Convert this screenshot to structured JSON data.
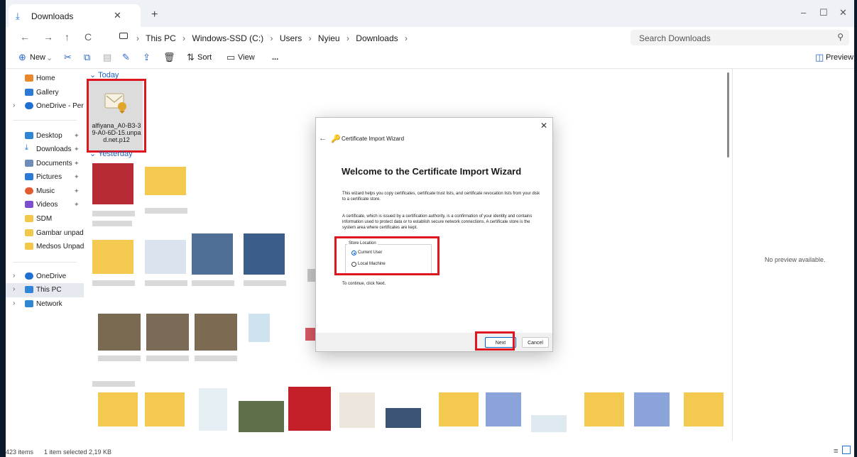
{
  "tab": {
    "title": "Downloads",
    "close": "✕",
    "new": "+"
  },
  "window_controls": [
    "–",
    "☐",
    "✕"
  ],
  "nav_buttons": [
    "←",
    "→",
    "↑",
    "C"
  ],
  "breadcrumb": [
    "This PC",
    "Windows-SSD (C:)",
    "Users",
    "Nyieu",
    "Downloads"
  ],
  "search": {
    "placeholder": "Search Downloads"
  },
  "toolbar": {
    "new_label": "New",
    "sort_label": "Sort",
    "view_label": "View",
    "more_label": "...",
    "preview_label": "Preview"
  },
  "sidebar": {
    "items": [
      {
        "label": "Home",
        "icon": "home-icon",
        "color": "#e9872b"
      },
      {
        "label": "Gallery",
        "icon": "gallery-icon",
        "color": "#2b7bd6"
      },
      {
        "label": "OneDrive - Persona",
        "icon": "cloud-icon",
        "color": "#1f6fd1"
      },
      {
        "label": "Desktop",
        "icon": "desktop-icon",
        "color": "#2f86d4"
      },
      {
        "label": "Downloads",
        "icon": "download-icon",
        "color": "#1f6fd1"
      },
      {
        "label": "Documents",
        "icon": "documents-icon",
        "color": "#6c8db8"
      },
      {
        "label": "Pictures",
        "icon": "pictures-icon",
        "color": "#2b7bd6"
      },
      {
        "label": "Music",
        "icon": "music-icon",
        "color": "#e25b32"
      },
      {
        "label": "Videos",
        "icon": "videos-icon",
        "color": "#7b4fd0"
      },
      {
        "label": "SDM",
        "icon": "folder-icon",
        "color": "#f2c84b"
      },
      {
        "label": "Gambar unpad",
        "icon": "folder-icon",
        "color": "#f2c84b"
      },
      {
        "label": "Medsos Unpad",
        "icon": "folder-icon",
        "color": "#f2c84b"
      },
      {
        "label": "OneDrive",
        "icon": "cloud-icon",
        "color": "#1f6fd1"
      },
      {
        "label": "This PC",
        "icon": "pc-icon",
        "color": "#2f86d4"
      },
      {
        "label": "Network",
        "icon": "network-icon",
        "color": "#2f86d4"
      }
    ]
  },
  "groups": {
    "today": "Today",
    "yesterday": "Yesterday"
  },
  "selected_file": {
    "name": "alfiyana_A0-B3-39-A0-6D-15.unpad.net.p12"
  },
  "preview_pane": {
    "message": "No preview available."
  },
  "status_bar": {
    "items": "423 items",
    "selected": "1 item selected  2,19 KB"
  },
  "dialog": {
    "title": "Certificate Import Wizard",
    "heading": "Welcome to the Certificate Import Wizard",
    "para1": "This wizard helps you copy certificates, certificate trust lists, and certificate revocation lists from your disk to a certificate store.",
    "para2": "A certificate, which is issued by a certification authority, is a confirmation of your identity and contains information used to protect data or to establish secure network connections. A certificate store is the system area where certificates are kept.",
    "store_location_label": "Store Location",
    "options": [
      "Current User",
      "Local Machine"
    ],
    "selected_option": "Current User",
    "continue_text": "To continue, click Next.",
    "next_label": "Next",
    "cancel_label": "Cancel",
    "close": "✕",
    "back": "←"
  },
  "colors": {
    "highlight": "#e0161e",
    "accent": "#0063c5",
    "group_header": "#1f5fbf"
  }
}
